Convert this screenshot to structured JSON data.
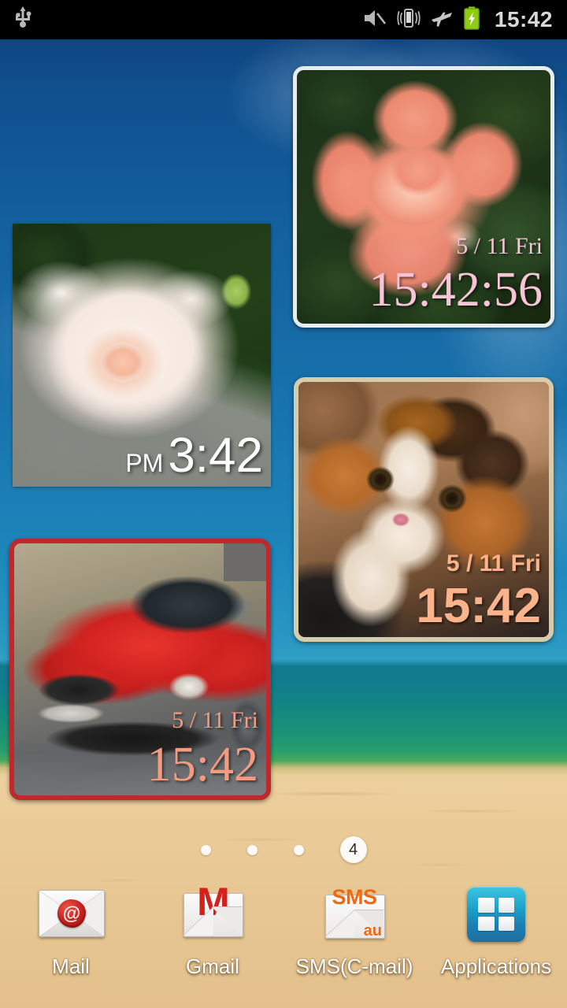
{
  "statusbar": {
    "clock": "15:42",
    "icons": [
      {
        "name": "usb-icon",
        "label": "USB connected"
      },
      {
        "name": "sound-muted-icon",
        "label": "Sound off"
      },
      {
        "name": "vibrate-icon",
        "label": "Vibrate"
      },
      {
        "name": "airplane-mode-icon",
        "label": "Airplane mode"
      },
      {
        "name": "battery-charging-icon",
        "label": "Battery charging"
      }
    ]
  },
  "widgets": [
    {
      "id": "rose-pink",
      "name": "photo-clock-widget-pink-rose",
      "photo": "pink rose",
      "date": "5 / 11 Fri",
      "time": "15:42:56",
      "text_color": "#f8c4d8",
      "frame_color": "#e7ecef"
    },
    {
      "id": "rose-white",
      "name": "photo-clock-widget-white-rose",
      "photo": "white rose",
      "ampm": "PM",
      "time": "3:42",
      "text_color": "#ffffff",
      "frame_color": "none"
    },
    {
      "id": "cat",
      "name": "photo-clock-widget-kitten",
      "photo": "calico kitten",
      "date": "5 / 11 Fri",
      "time": "15:42",
      "text_color": "#fbb38c",
      "frame_color": "#d6ccab"
    },
    {
      "id": "car",
      "name": "photo-clock-widget-car",
      "photo": "red Volvo S60",
      "date": "5 / 11 Fri",
      "time": "15:42",
      "text_color": "#f59b80",
      "frame_color": "#c0292b"
    }
  ],
  "page_indicator": {
    "total_pages": 4,
    "current_page": "4",
    "dots": [
      "",
      "",
      ""
    ]
  },
  "dock": {
    "items": [
      {
        "label": "Mail",
        "icon": "mail-envelope-seal-icon"
      },
      {
        "label": "Gmail",
        "icon": "gmail-envelope-icon"
      },
      {
        "label": "SMS(C-mail)",
        "icon": "sms-cmail-envelope-icon"
      },
      {
        "label": "Applications",
        "icon": "applications-grid-icon"
      }
    ]
  },
  "wallpaper": {
    "name": "beach-wallpaper",
    "sky_color": "#12609d",
    "sea_color": "#1a8a84",
    "sand_color": "#eacb96"
  }
}
